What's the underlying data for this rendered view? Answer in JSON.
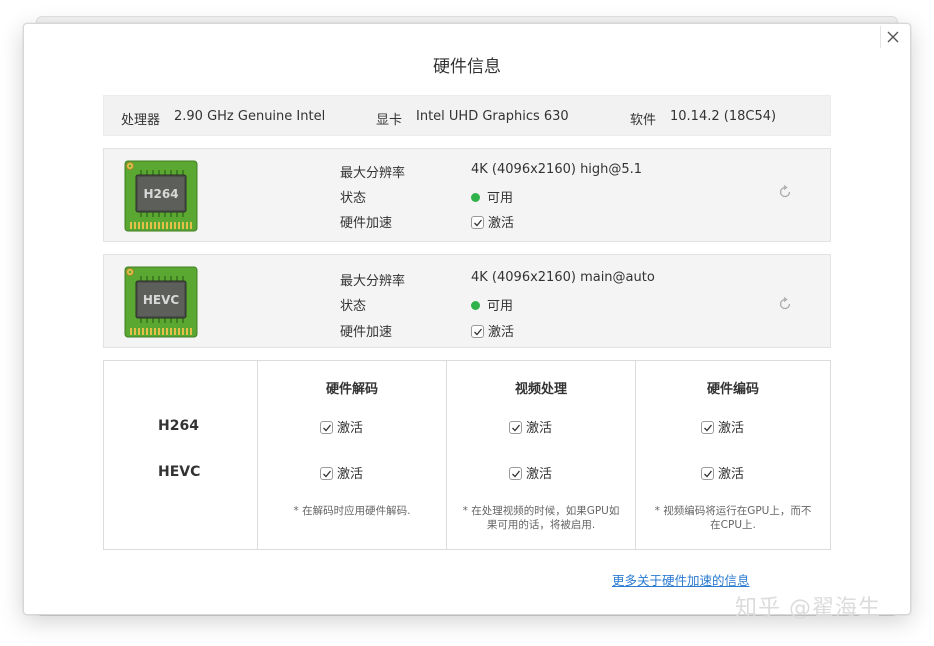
{
  "dialog": {
    "title": "硬件信息",
    "close_icon": "close-icon"
  },
  "info": {
    "cpu_label": "处理器",
    "cpu_value": "2.90 GHz Genuine Intel",
    "gpu_label": "显卡",
    "gpu_value": "Intel UHD Graphics 630",
    "software_label": "软件",
    "software_value": "10.14.2 (18C54)"
  },
  "codecs": [
    {
      "chip_label": "H264",
      "max_res_label": "最大分辨率",
      "max_res_value": "4K (4096x2160) high@5.1",
      "status_label": "状态",
      "status_value": "可用",
      "hw_accel_label": "硬件加速",
      "hw_accel_value": "激活",
      "hw_accel_checked": true
    },
    {
      "chip_label": "HEVC",
      "max_res_label": "最大分辨率",
      "max_res_value": "4K (4096x2160) main@auto",
      "status_label": "状态",
      "status_value": "可用",
      "hw_accel_label": "硬件加速",
      "hw_accel_value": "激活",
      "hw_accel_checked": true
    }
  ],
  "matrix": {
    "columns": [
      "硬件解码",
      "视频处理",
      "硬件编码"
    ],
    "rows": [
      {
        "name": "H264",
        "cells": [
          "激活",
          "激活",
          "激活"
        ]
      },
      {
        "name": "HEVC",
        "cells": [
          "激活",
          "激活",
          "激活"
        ]
      }
    ],
    "notes": [
      [
        "* 在解码时应用硬件解码."
      ],
      [
        "* 在处理视频的时候，如果GPU如",
        "果可用的话，将被启用."
      ],
      [
        "* 视频编码将运行在GPU上，而不",
        "在CPU上."
      ]
    ]
  },
  "more_link": "更多关于硬件加速的信息",
  "watermark": "知乎 @翟海生",
  "colors": {
    "status_green": "#2fb24a",
    "link_blue": "#2a7bd1",
    "chip_green": "#5aa832"
  }
}
